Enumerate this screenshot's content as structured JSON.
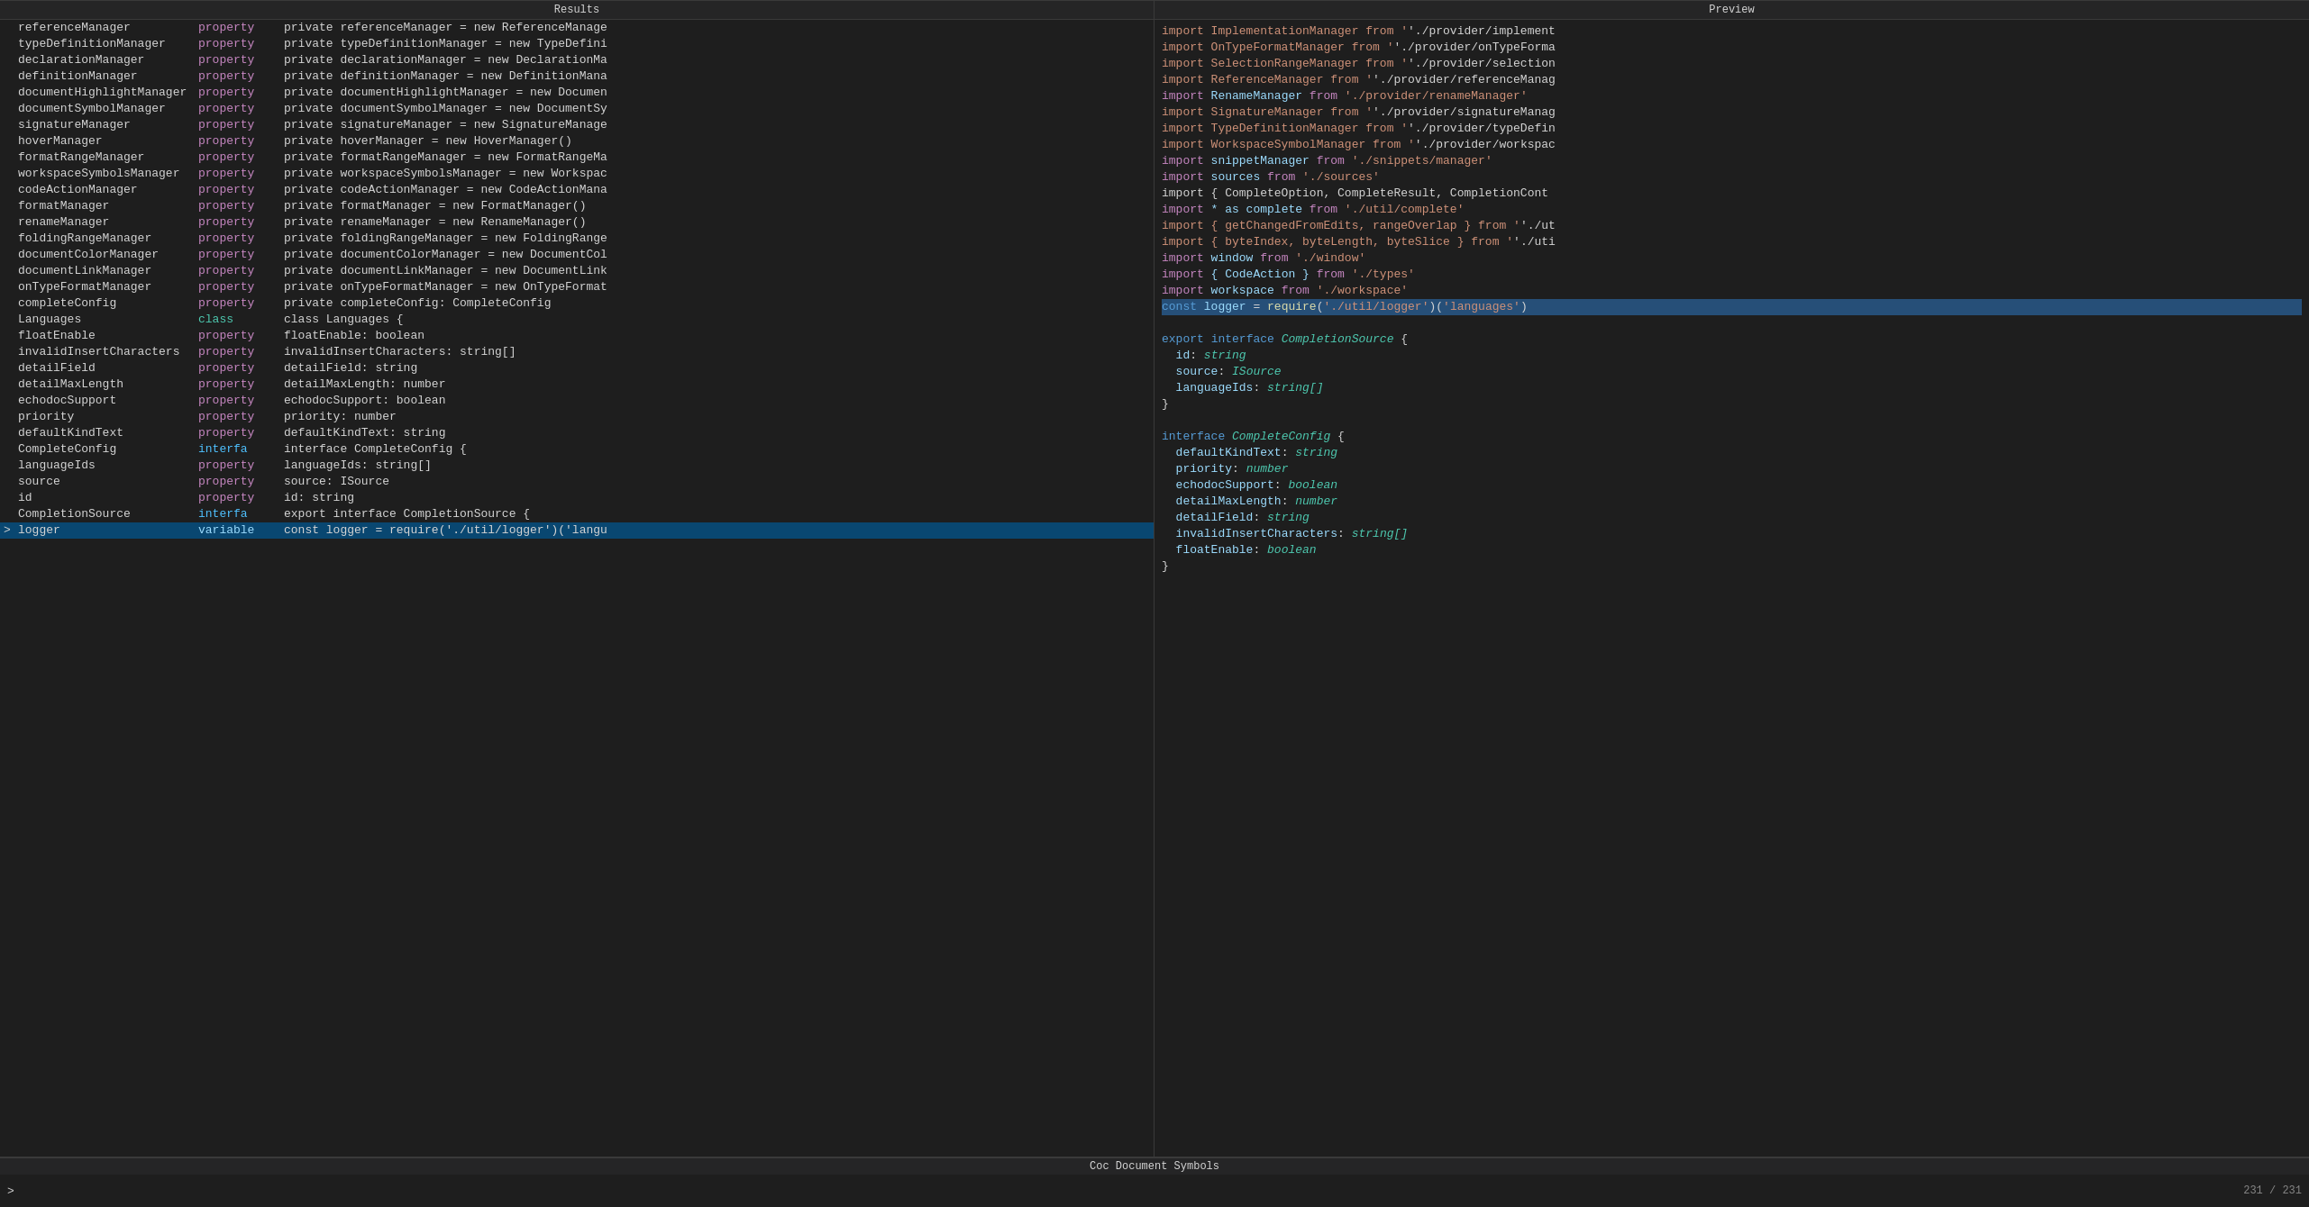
{
  "panels": {
    "results_title": "Results",
    "preview_title": "Preview",
    "bottom_title": "Coc Document Symbols",
    "counter": "231 / 231",
    "prompt": ">"
  },
  "results": [
    {
      "name": "referenceManager",
      "kind": "property",
      "detail": "private referenceManager = new ReferenceManage"
    },
    {
      "name": "typeDefinitionManager",
      "kind": "property",
      "detail": "private typeDefinitionManager = new TypeDefini"
    },
    {
      "name": "declarationManager",
      "kind": "property",
      "detail": "private declarationManager = new DeclarationMa"
    },
    {
      "name": "definitionManager",
      "kind": "property",
      "detail": "private definitionManager = new DefinitionMana"
    },
    {
      "name": "documentHighlightManager",
      "kind": "property",
      "detail": "private documentHighlightManager = new Documen"
    },
    {
      "name": "documentSymbolManager",
      "kind": "property",
      "detail": "private documentSymbolManager = new DocumentSy"
    },
    {
      "name": "signatureManager",
      "kind": "property",
      "detail": "private signatureManager = new SignatureManage"
    },
    {
      "name": "hoverManager",
      "kind": "property",
      "detail": "private hoverManager = new HoverManager()"
    },
    {
      "name": "formatRangeManager",
      "kind": "property",
      "detail": "private formatRangeManager = new FormatRangeMa"
    },
    {
      "name": "workspaceSymbolsManager",
      "kind": "property",
      "detail": "private workspaceSymbolsManager = new Workspac"
    },
    {
      "name": "codeActionManager",
      "kind": "property",
      "detail": "private codeActionManager = new CodeActionMana"
    },
    {
      "name": "formatManager",
      "kind": "property",
      "detail": "private formatManager = new FormatManager()"
    },
    {
      "name": "renameManager",
      "kind": "property",
      "detail": "private renameManager = new RenameManager()"
    },
    {
      "name": "foldingRangeManager",
      "kind": "property",
      "detail": "private foldingRangeManager = new FoldingRange"
    },
    {
      "name": "documentColorManager",
      "kind": "property",
      "detail": "private documentColorManager = new DocumentCol"
    },
    {
      "name": "documentLinkManager",
      "kind": "property",
      "detail": "private documentLinkManager = new DocumentLink"
    },
    {
      "name": "onTypeFormatManager",
      "kind": "property",
      "detail": "private onTypeFormatManager = new OnTypeFormat"
    },
    {
      "name": "completeConfig",
      "kind": "property",
      "detail": "private completeConfig: CompleteConfig"
    },
    {
      "name": "Languages",
      "kind": "class",
      "detail": "class Languages {"
    },
    {
      "name": "floatEnable",
      "kind": "property",
      "detail": "floatEnable: boolean"
    },
    {
      "name": "invalidInsertCharacters",
      "kind": "property",
      "detail": "invalidInsertCharacters: string[]"
    },
    {
      "name": "detailField",
      "kind": "property",
      "detail": "detailField: string"
    },
    {
      "name": "detailMaxLength",
      "kind": "property",
      "detail": "detailMaxLength: number"
    },
    {
      "name": "echodocSupport",
      "kind": "property",
      "detail": "echodocSupport: boolean"
    },
    {
      "name": "priority",
      "kind": "property",
      "detail": "priority: number"
    },
    {
      "name": "defaultKindText",
      "kind": "property",
      "detail": "defaultKindText: string"
    },
    {
      "name": "CompleteConfig",
      "kind": "interfa",
      "detail": "interface CompleteConfig {"
    },
    {
      "name": "languageIds",
      "kind": "property",
      "detail": "languageIds: string[]"
    },
    {
      "name": "source",
      "kind": "property",
      "detail": "source: ISource"
    },
    {
      "name": "id",
      "kind": "property",
      "detail": "id: string"
    },
    {
      "name": "CompletionSource",
      "kind": "interfa",
      "detail": "export interface CompletionSource {"
    },
    {
      "name": "logger",
      "kind": "variable",
      "detail": "const logger = require('./util/logger')('langu",
      "active": true
    }
  ],
  "preview_lines": [
    {
      "text": "import ImplementationManager from './provider/implement",
      "type": "import"
    },
    {
      "text": "import OnTypeFormatManager from './provider/onTypeForma",
      "type": "import"
    },
    {
      "text": "import SelectionRangeManager from './provider/selection",
      "type": "import"
    },
    {
      "text": "import ReferenceManager from './provider/referenceManag",
      "type": "import"
    },
    {
      "text": "import RenameManager from './provider/renameManager'",
      "type": "import"
    },
    {
      "text": "import SignatureManager from './provider/signatureManag",
      "type": "import"
    },
    {
      "text": "import TypeDefinitionManager from './provider/typeDefin",
      "type": "import"
    },
    {
      "text": "import WorkspaceSymbolManager from './provider/workspac",
      "type": "import"
    },
    {
      "text": "import snippetManager from './snippets/manager'",
      "type": "import"
    },
    {
      "text": "import sources from './sources'",
      "type": "import"
    },
    {
      "text": "import { CompleteOption, CompleteResult, CompletionCont",
      "type": "import"
    },
    {
      "text": "import * as complete from './util/complete'",
      "type": "import"
    },
    {
      "text": "import { getChangedFromEdits, rangeOverlap } from './ut",
      "type": "import"
    },
    {
      "text": "import { byteIndex, byteLength, byteSlice } from './uti",
      "type": "import"
    },
    {
      "text": "import window from './window'",
      "type": "import"
    },
    {
      "text": "import { CodeAction } from './types'",
      "type": "import"
    },
    {
      "text": "import workspace from './workspace'",
      "type": "import"
    },
    {
      "text": "const logger = require('./util/logger')('languages')",
      "type": "const-highlight"
    },
    {
      "text": "",
      "type": "empty"
    },
    {
      "text": "export interface CompletionSource {",
      "type": "interface-decl"
    },
    {
      "text": "  id: string",
      "type": "interface-body"
    },
    {
      "text": "  source: ISource",
      "type": "interface-body"
    },
    {
      "text": "  languageIds: string[]",
      "type": "interface-body"
    },
    {
      "text": "}",
      "type": "brace"
    },
    {
      "text": "",
      "type": "empty"
    },
    {
      "text": "interface CompleteConfig {",
      "type": "interface-decl2"
    },
    {
      "text": "  defaultKindText: string",
      "type": "interface-body"
    },
    {
      "text": "  priority: number",
      "type": "interface-body"
    },
    {
      "text": "  echodocSupport: boolean",
      "type": "interface-body"
    },
    {
      "text": "  detailMaxLength: number",
      "type": "interface-body"
    },
    {
      "text": "  detailField: string",
      "type": "interface-body"
    },
    {
      "text": "  invalidInsertCharacters: string[]",
      "type": "interface-body"
    },
    {
      "text": "  floatEnable: boolean",
      "type": "interface-body"
    },
    {
      "text": "}",
      "type": "brace"
    }
  ]
}
